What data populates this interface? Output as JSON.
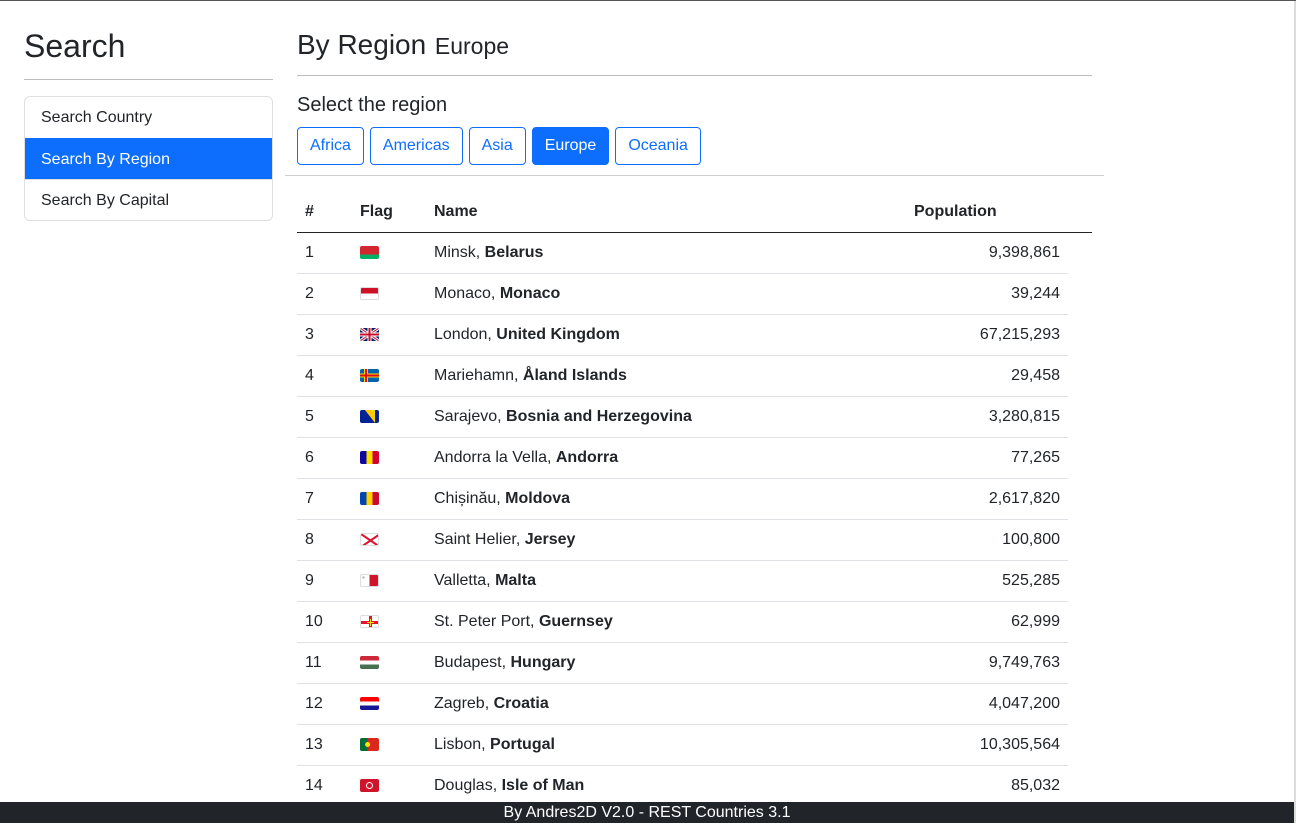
{
  "sidebar": {
    "title": "Search",
    "items": [
      {
        "label": "Search Country",
        "active": false
      },
      {
        "label": "Search By Region",
        "active": true
      },
      {
        "label": "Search By Capital",
        "active": false
      }
    ]
  },
  "main": {
    "title_lead": "By Region",
    "title_region": "Europe",
    "section_title": "Select the region",
    "regions": [
      {
        "label": "Africa",
        "active": false
      },
      {
        "label": "Americas",
        "active": false
      },
      {
        "label": "Asia",
        "active": false
      },
      {
        "label": "Europe",
        "active": true
      },
      {
        "label": "Oceania",
        "active": false
      }
    ]
  },
  "table": {
    "headers": {
      "num": "#",
      "flag": "Flag",
      "name": "Name",
      "population": "Population"
    },
    "rows": [
      {
        "num": "1",
        "capital": "Minsk, ",
        "country": "Belarus",
        "population": "9,398,861",
        "flag": "belarus-flag-icon"
      },
      {
        "num": "2",
        "capital": "Monaco, ",
        "country": "Monaco",
        "population": "39,244",
        "flag": "monaco-flag-icon"
      },
      {
        "num": "3",
        "capital": "London, ",
        "country": "United Kingdom",
        "population": "67,215,293",
        "flag": "united-kingdom-flag-icon"
      },
      {
        "num": "4",
        "capital": "Mariehamn, ",
        "country": "Åland Islands",
        "population": "29,458",
        "flag": "aland-islands-flag-icon"
      },
      {
        "num": "5",
        "capital": "Sarajevo, ",
        "country": "Bosnia and Herzegovina",
        "population": "3,280,815",
        "flag": "bosnia-flag-icon"
      },
      {
        "num": "6",
        "capital": "Andorra la Vella, ",
        "country": "Andorra",
        "population": "77,265",
        "flag": "andorra-flag-icon"
      },
      {
        "num": "7",
        "capital": "Chișinău, ",
        "country": "Moldova",
        "population": "2,617,820",
        "flag": "moldova-flag-icon"
      },
      {
        "num": "8",
        "capital": "Saint Helier, ",
        "country": "Jersey",
        "population": "100,800",
        "flag": "jersey-flag-icon"
      },
      {
        "num": "9",
        "capital": "Valletta, ",
        "country": "Malta",
        "population": "525,285",
        "flag": "malta-flag-icon"
      },
      {
        "num": "10",
        "capital": "St. Peter Port, ",
        "country": "Guernsey",
        "population": "62,999",
        "flag": "guernsey-flag-icon"
      },
      {
        "num": "11",
        "capital": "Budapest, ",
        "country": "Hungary",
        "population": "9,749,763",
        "flag": "hungary-flag-icon"
      },
      {
        "num": "12",
        "capital": "Zagreb, ",
        "country": "Croatia",
        "population": "4,047,200",
        "flag": "croatia-flag-icon"
      },
      {
        "num": "13",
        "capital": "Lisbon, ",
        "country": "Portugal",
        "population": "10,305,564",
        "flag": "portugal-flag-icon"
      },
      {
        "num": "14",
        "capital": "Douglas, ",
        "country": "Isle of Man",
        "population": "85,032",
        "flag": "isle-of-man-flag-icon"
      }
    ]
  },
  "footer": {
    "text": "By Andres2D V2.0 - REST Countries 3.1"
  },
  "colors": {
    "accent": "#0d6efd",
    "footer_bg": "#212529",
    "text": "#212529"
  }
}
